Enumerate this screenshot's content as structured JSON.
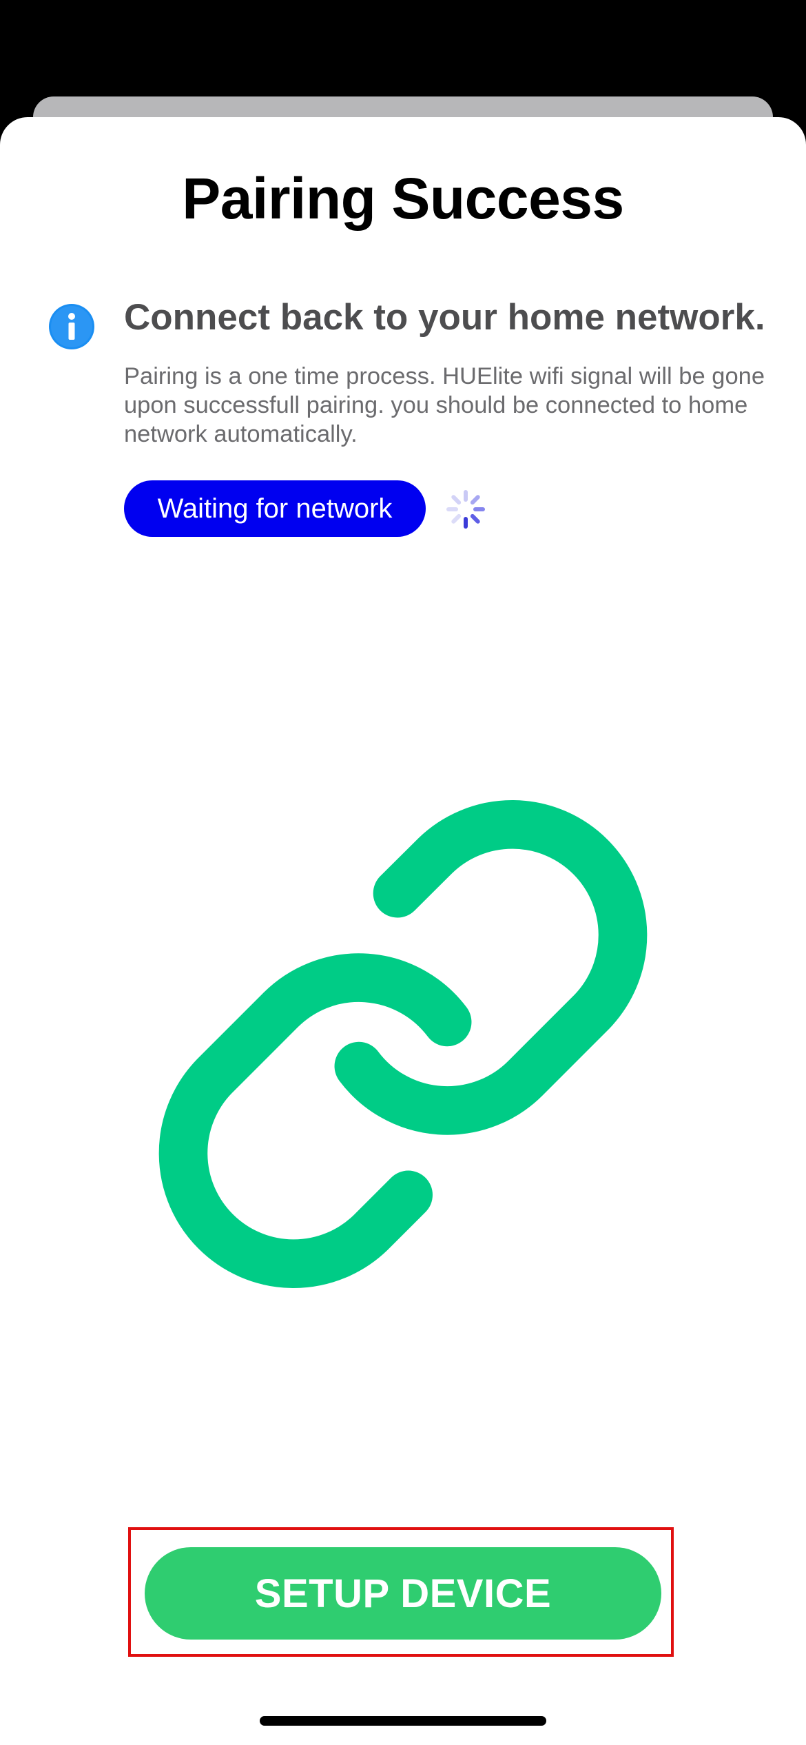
{
  "modal": {
    "title": "Pairing Success"
  },
  "info": {
    "icon": "info-icon",
    "heading": "Connect back to your home network.",
    "body": "Pairing is a one time process. HUElite wifi signal will be gone upon successfull pairing. you should be connected to home network automatically."
  },
  "status": {
    "label": "Waiting for network",
    "indicator": "loading-spinner-icon"
  },
  "illustration": {
    "icon": "link-icon",
    "color": "#00cc86"
  },
  "actions": {
    "setup_label": "SETUP DEVICE"
  },
  "colors": {
    "pill": "#0000f0",
    "button": "#2fcd70",
    "info_icon": "#1a8ef2"
  }
}
